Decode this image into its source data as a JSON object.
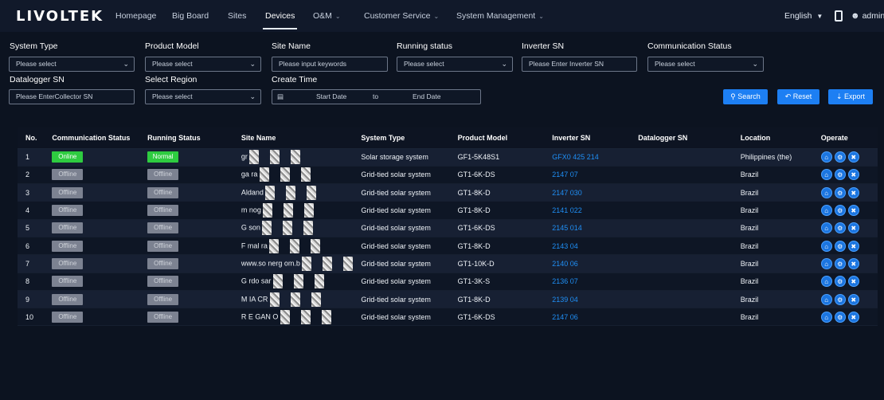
{
  "app": {
    "logo": "LIVOLTEK"
  },
  "nav": {
    "homepage": "Homepage",
    "big_board": "Big Board",
    "sites": "Sites",
    "devices": "Devices",
    "om": "O&M",
    "customer_service": "Customer Service",
    "system_management": "System Management"
  },
  "topright": {
    "language": "English",
    "user": "admin"
  },
  "filters": {
    "system_type": {
      "label": "System Type",
      "placeholder": "Please select"
    },
    "product_model": {
      "label": "Product Model",
      "placeholder": "Please select"
    },
    "site_name": {
      "label": "Site Name",
      "placeholder": "Please input keywords"
    },
    "running_status": {
      "label": "Running status",
      "placeholder": "Please select"
    },
    "inverter_sn": {
      "label": "Inverter SN",
      "placeholder": "Please Enter Inverter SN"
    },
    "communication_status": {
      "label": "Communication Status",
      "placeholder": "Please select"
    },
    "datalogger_sn": {
      "label": "Datalogger SN",
      "placeholder": "Please EnterCollector SN"
    },
    "select_region": {
      "label": "Select Region",
      "placeholder": "Please select"
    },
    "create_time": {
      "label": "Create Time",
      "start": "Start Date",
      "to": "to",
      "end": "End Date"
    }
  },
  "buttons": {
    "search": "Search",
    "reset": "Reset",
    "export": "Export"
  },
  "table": {
    "headers": [
      "No.",
      "Communication Status",
      "Running Status",
      "Site Name",
      "System Type",
      "Product Model",
      "Inverter SN",
      "Datalogger SN",
      "Location",
      "Operate"
    ],
    "rows": [
      {
        "no": "1",
        "comm": "Online",
        "run": "Normal",
        "site": "gr",
        "type": "Solar storage system",
        "model": "GF1-5K48S1",
        "sn": "GFX0 425 214",
        "logger": "",
        "location": "Philippines (the)"
      },
      {
        "no": "2",
        "comm": "Offline",
        "run": "Offline",
        "site": "ga ra",
        "type": "Grid-tied solar system",
        "model": "GT1-6K-DS",
        "sn": "2147 07",
        "logger": "",
        "location": "Brazil"
      },
      {
        "no": "3",
        "comm": "Offline",
        "run": "Offline",
        "site": "Aldand",
        "type": "Grid-tied solar system",
        "model": "GT1-8K-D",
        "sn": "2147 030",
        "logger": "",
        "location": "Brazil"
      },
      {
        "no": "4",
        "comm": "Offline",
        "run": "Offline",
        "site": "m nog",
        "type": "Grid-tied solar system",
        "model": "GT1-8K-D",
        "sn": "2141 022",
        "logger": "",
        "location": "Brazil"
      },
      {
        "no": "5",
        "comm": "Offline",
        "run": "Offline",
        "site": "G son",
        "type": "Grid-tied solar system",
        "model": "GT1-6K-DS",
        "sn": "2145 014",
        "logger": "",
        "location": "Brazil"
      },
      {
        "no": "6",
        "comm": "Offline",
        "run": "Offline",
        "site": "F mal ra",
        "type": "Grid-tied solar system",
        "model": "GT1-8K-D",
        "sn": "2143 04",
        "logger": "",
        "location": "Brazil"
      },
      {
        "no": "7",
        "comm": "Offline",
        "run": "Offline",
        "site": "www.so nerg om.b",
        "type": "Grid-tied solar system",
        "model": "GT1-10K-D",
        "sn": "2140 06",
        "logger": "",
        "location": "Brazil"
      },
      {
        "no": "8",
        "comm": "Offline",
        "run": "Offline",
        "site": "G rdo sar",
        "type": "Grid-tied solar system",
        "model": "GT1-3K-S",
        "sn": "2136 07",
        "logger": "",
        "location": "Brazil"
      },
      {
        "no": "9",
        "comm": "Offline",
        "run": "Offline",
        "site": "M IA CR",
        "type": "Grid-tied solar system",
        "model": "GT1-8K-D",
        "sn": "2139 04",
        "logger": "",
        "location": "Brazil"
      },
      {
        "no": "10",
        "comm": "Offline",
        "run": "Offline",
        "site": "R E GAN O",
        "type": "Grid-tied solar system",
        "model": "GT1-6K-DS",
        "sn": "2147 06",
        "logger": "",
        "location": "Brazil"
      }
    ]
  },
  "colors": {
    "accent": "#1d7ff3",
    "online": "#2ecc40",
    "offline": "#7c8291",
    "background": "#0c1320",
    "link": "#1f8ff5"
  },
  "icons": {
    "dropdown": "chevron-down-icon",
    "calendar": "calendar-icon",
    "search": "search-icon",
    "reset": "reset-icon",
    "export": "export-icon",
    "phone": "phone-icon",
    "user": "user-icon",
    "op_home": "home-icon",
    "op_settings": "settings-icon",
    "op_delete": "delete-icon"
  }
}
